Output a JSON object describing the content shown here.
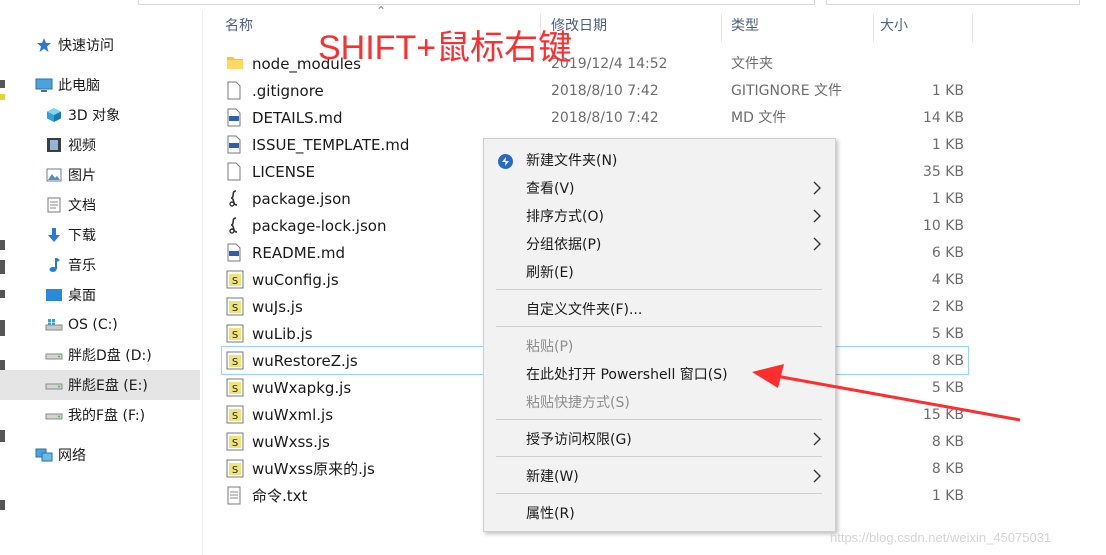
{
  "annotation": "SHIFT+鼠标右键",
  "columns": {
    "name": "名称",
    "date": "修改日期",
    "type": "类型",
    "size": "大小"
  },
  "sidebar": {
    "items": [
      {
        "label": "快速访问",
        "icon": "star-icon"
      },
      {
        "label": "此电脑",
        "icon": "computer-icon"
      },
      {
        "label": "3D 对象",
        "icon": "cube-icon"
      },
      {
        "label": "视频",
        "icon": "film-icon"
      },
      {
        "label": "图片",
        "icon": "picture-icon"
      },
      {
        "label": "文档",
        "icon": "document-icon"
      },
      {
        "label": "下载",
        "icon": "download-icon"
      },
      {
        "label": "音乐",
        "icon": "music-icon"
      },
      {
        "label": "桌面",
        "icon": "desktop-icon"
      },
      {
        "label": "OS (C:)",
        "icon": "windows-drive-icon"
      },
      {
        "label": "胖彪D盘 (D:)",
        "icon": "drive-icon"
      },
      {
        "label": "胖彪E盘 (E:)",
        "icon": "drive-icon"
      },
      {
        "label": "我的F盘 (F:)",
        "icon": "drive-icon"
      },
      {
        "label": "网络",
        "icon": "network-icon"
      }
    ]
  },
  "files": [
    {
      "name": "node_modules",
      "date": "2019/12/4 14:52",
      "type": "文件夹",
      "size": "",
      "icon": "folder-icon"
    },
    {
      "name": ".gitignore",
      "date": "2018/8/10 7:42",
      "type": "GITIGNORE 文件",
      "size": "1 KB",
      "icon": "file-icon"
    },
    {
      "name": "DETAILS.md",
      "date": "2018/8/10 7:42",
      "type": "MD 文件",
      "size": "14 KB",
      "icon": "md-file-icon"
    },
    {
      "name": "ISSUE_TEMPLATE.md",
      "date": "",
      "type": "",
      "size": "1 KB",
      "icon": "md-file-icon"
    },
    {
      "name": "LICENSE",
      "date": "",
      "type": "",
      "size": "35 KB",
      "icon": "file-icon"
    },
    {
      "name": "package.json",
      "date": "",
      "type": "",
      "size": "1 KB",
      "icon": "json-file-icon"
    },
    {
      "name": "package-lock.json",
      "date": "",
      "type": "",
      "size": "10 KB",
      "icon": "json-file-icon"
    },
    {
      "name": "README.md",
      "date": "",
      "type": "",
      "size": "6 KB",
      "icon": "md-file-icon"
    },
    {
      "name": "wuConfig.js",
      "date": "",
      "type": "",
      "size": "4 KB",
      "icon": "js-file-icon"
    },
    {
      "name": "wuJs.js",
      "date": "",
      "type": "",
      "size": "2 KB",
      "icon": "js-file-icon"
    },
    {
      "name": "wuLib.js",
      "date": "",
      "type": "",
      "size": "5 KB",
      "icon": "js-file-icon"
    },
    {
      "name": "wuRestoreZ.js",
      "date": "",
      "type": "",
      "size": "8 KB",
      "icon": "js-file-icon"
    },
    {
      "name": "wuWxapkg.js",
      "date": "",
      "type": "",
      "size": "5 KB",
      "icon": "js-file-icon"
    },
    {
      "name": "wuWxml.js",
      "date": "",
      "type": "",
      "size": "15 KB",
      "icon": "js-file-icon"
    },
    {
      "name": "wuWxss.js",
      "date": "",
      "type": "",
      "size": "8 KB",
      "icon": "js-file-icon"
    },
    {
      "name": "wuWxss原来的.js",
      "date": "",
      "type": "",
      "size": "8 KB",
      "icon": "js-file-icon"
    },
    {
      "name": "命令.txt",
      "date": "",
      "type": "",
      "size": "1 KB",
      "icon": "text-file-icon"
    }
  ],
  "context_menu": {
    "items": [
      {
        "label": "新建文件夹(N)",
        "enabled": true,
        "submenu": false
      },
      {
        "label": "查看(V)",
        "enabled": true,
        "submenu": true
      },
      {
        "label": "排序方式(O)",
        "enabled": true,
        "submenu": true
      },
      {
        "label": "分组依据(P)",
        "enabled": true,
        "submenu": true
      },
      {
        "label": "刷新(E)",
        "enabled": true,
        "submenu": false
      },
      {
        "label": "自定义文件夹(F)...",
        "enabled": true,
        "submenu": false
      },
      {
        "label": "粘贴(P)",
        "enabled": false,
        "submenu": false
      },
      {
        "label": "在此处打开 Powershell 窗口(S)",
        "enabled": true,
        "submenu": false
      },
      {
        "label": "粘贴快捷方式(S)",
        "enabled": false,
        "submenu": false
      },
      {
        "label": "授予访问权限(G)",
        "enabled": true,
        "submenu": true
      },
      {
        "label": "新建(W)",
        "enabled": true,
        "submenu": true
      },
      {
        "label": "属性(R)",
        "enabled": true,
        "submenu": false
      }
    ]
  },
  "colors": {
    "annotation": "#ff2d2d",
    "selection_outline": "#99d1ff",
    "selected_nav": "#e5e5e5"
  },
  "watermark": "https://blog.csdn.net/weixin_45075031"
}
